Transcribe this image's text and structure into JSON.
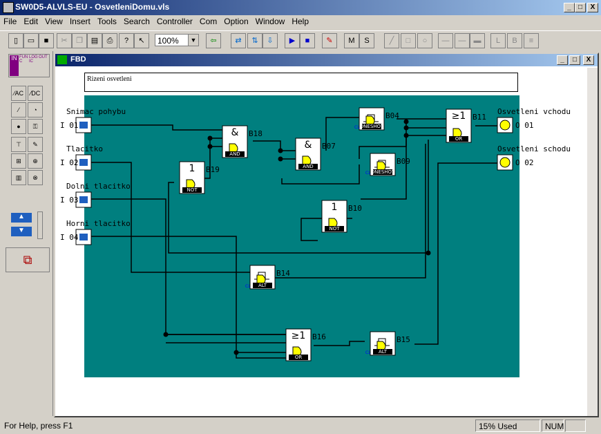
{
  "window": {
    "title": "SW0D5-ALVLS-EU - OsvetleniDomu.vls",
    "min": "_",
    "max": "□",
    "close": "X"
  },
  "menu": [
    "File",
    "Edit",
    "View",
    "Insert",
    "Tools",
    "Search",
    "Controller",
    "Com",
    "Option",
    "Window",
    "Help"
  ],
  "toolbar": {
    "zoom": "100%"
  },
  "left_panel": {
    "tab_in": "IN",
    "tab_func": "FUNC",
    "tab_logic": "LOGIC",
    "tab_out": "OUT"
  },
  "fbd": {
    "title": "FBD",
    "comment": "Rizeni osvetleni",
    "inputs": [
      {
        "id": "I 01",
        "label": "Snimac pohybu"
      },
      {
        "id": "I 02",
        "label": "Tlacitko"
      },
      {
        "id": "I 03",
        "label": "Dolni tlacitko"
      },
      {
        "id": "I 04",
        "label": "Horni tlacitko"
      }
    ],
    "outputs": [
      {
        "id": "O 01",
        "label": "Osvetleni vchodu"
      },
      {
        "id": "O 02",
        "label": "Osvetleni schodu"
      }
    ],
    "blocks": [
      {
        "id": "B18",
        "symbol": "&",
        "type": "AND"
      },
      {
        "id": "B07",
        "symbol": "&",
        "type": "AND"
      },
      {
        "id": "B19",
        "symbol": "1",
        "type": "NOT"
      },
      {
        "id": "B10",
        "symbol": "1",
        "type": "NOT"
      },
      {
        "id": "B04",
        "symbol": "",
        "type": "ONESHOT"
      },
      {
        "id": "B09",
        "symbol": "",
        "type": "ONESHOT"
      },
      {
        "id": "B11",
        "symbol": "≥1",
        "type": "OR"
      },
      {
        "id": "B16",
        "symbol": "≥1",
        "type": "OR"
      },
      {
        "id": "B14",
        "symbol": "",
        "type": "ALT"
      },
      {
        "id": "B15",
        "symbol": "",
        "type": "ALT"
      }
    ],
    "cl_label": "CL"
  },
  "status": {
    "help": "For Help, press F1",
    "used": "15% Used",
    "num": "NUM"
  }
}
